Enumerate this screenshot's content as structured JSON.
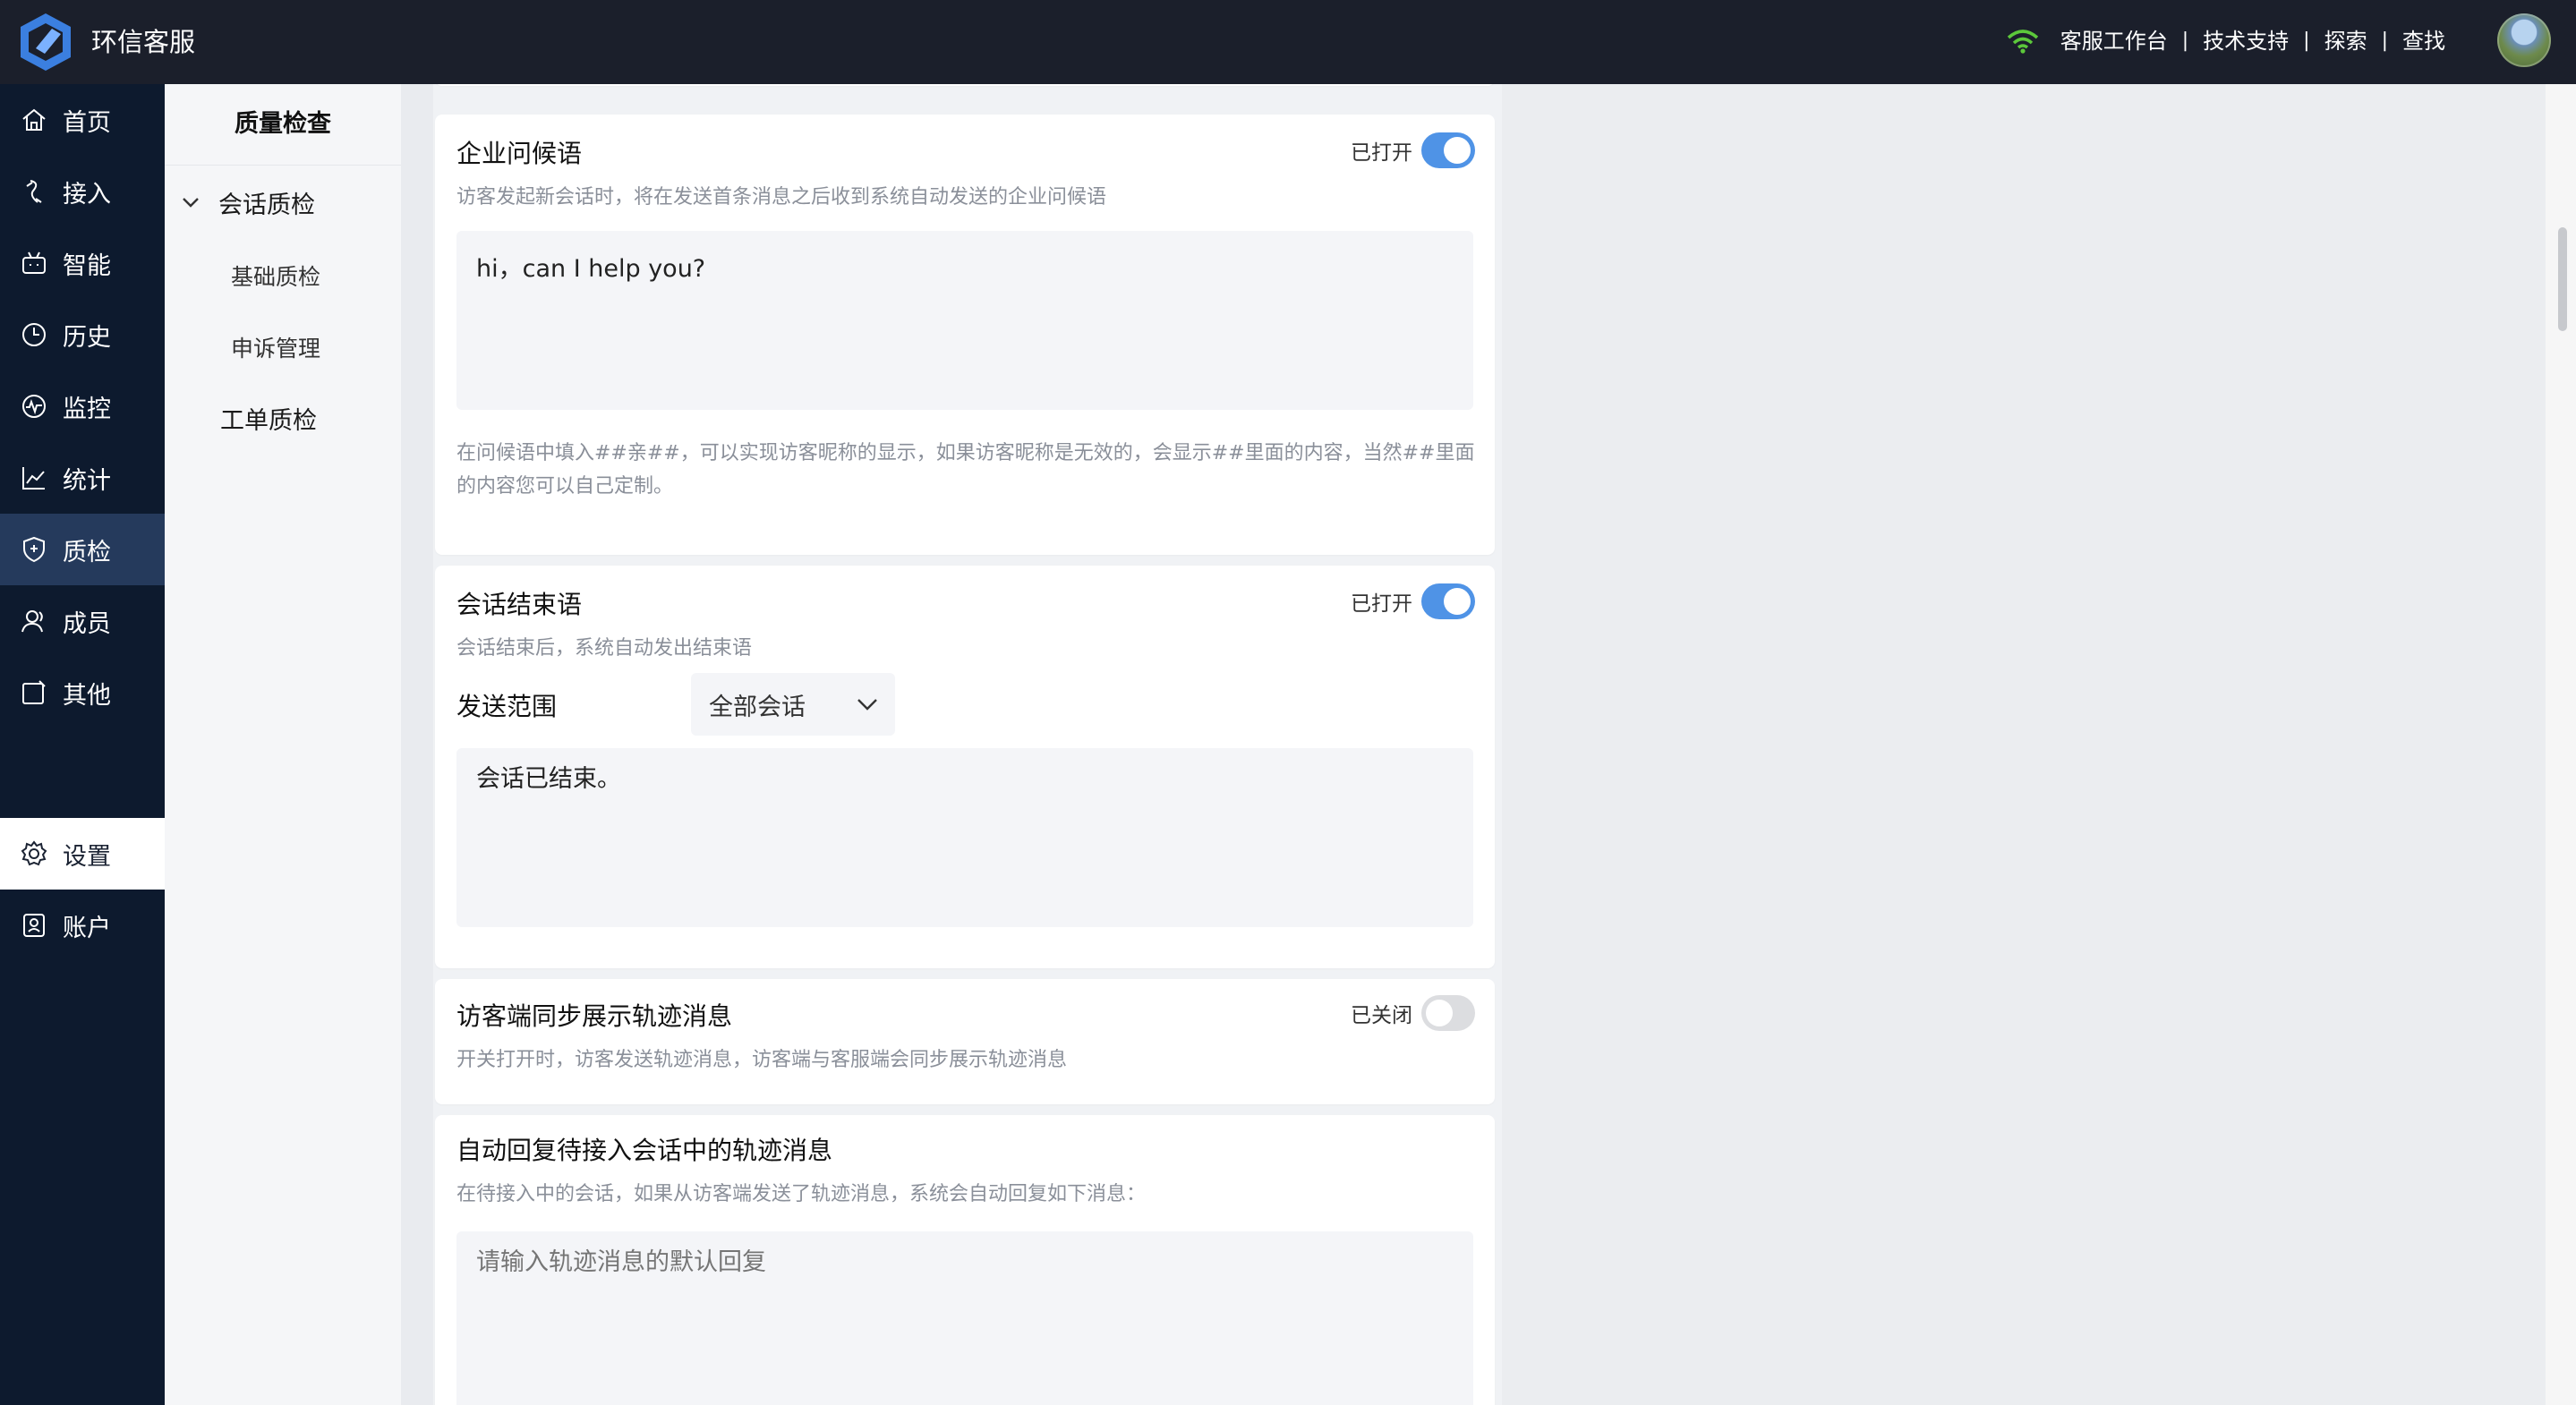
{
  "app": {
    "name": "环信客服"
  },
  "header": {
    "links": [
      "客服工作台",
      "技术支持",
      "探索",
      "查找"
    ],
    "separator": "|"
  },
  "nav": {
    "items": [
      {
        "label": "首页",
        "icon": "home-icon"
      },
      {
        "label": "接入",
        "icon": "access-icon"
      },
      {
        "label": "智能",
        "icon": "robot-icon"
      },
      {
        "label": "历史",
        "icon": "clock-icon"
      },
      {
        "label": "监控",
        "icon": "monitor-icon"
      },
      {
        "label": "统计",
        "icon": "chart-icon"
      },
      {
        "label": "质检",
        "icon": "shield-icon"
      },
      {
        "label": "成员",
        "icon": "user-icon"
      },
      {
        "label": "其他",
        "icon": "other-icon"
      }
    ],
    "settings": "设置",
    "account": "账户",
    "active": "质检",
    "selected": "设置"
  },
  "subnav": {
    "title": "质量检查",
    "group": "会话质检",
    "subitems": [
      "基础质检",
      "申诉管理"
    ],
    "other": "工单质检"
  },
  "cards": {
    "greeting": {
      "title": "企业问候语",
      "desc": "访客发起新会话时，将在发送首条消息之后收到系统自动发送的企业问候语",
      "switch_label": "已打开",
      "switch_on": true,
      "text": "hi，can I help you?",
      "hint": "在问候语中填入##亲##，可以实现访客昵称的显示，如果访客昵称是无效的，会显示##里面的内容，当然##里面的内容您可以自己定制。"
    },
    "ending": {
      "title": "会话结束语",
      "desc": "会话结束后，系统自动发出结束语",
      "switch_label": "已打开",
      "switch_on": true,
      "scope_label": "发送范围",
      "scope_value": "全部会话",
      "text": "会话已结束。"
    },
    "track": {
      "title": "访客端同步展示轨迹消息",
      "desc": "开关打开时，访客发送轨迹消息，访客端与客服端会同步展示轨迹消息",
      "switch_label": "已关闭",
      "switch_on": false
    },
    "auto_reply": {
      "title": "自动回复待接入会话中的轨迹消息",
      "desc": "在待接入中的会话，如果从访客端发送了轨迹消息，系统会自动回复如下消息：",
      "placeholder": "请输入轨迹消息的默认回复"
    }
  },
  "colors": {
    "accent": "#4f93e6",
    "nav_bg": "#0d1a2e",
    "topbar_bg": "#1b1f2b"
  }
}
